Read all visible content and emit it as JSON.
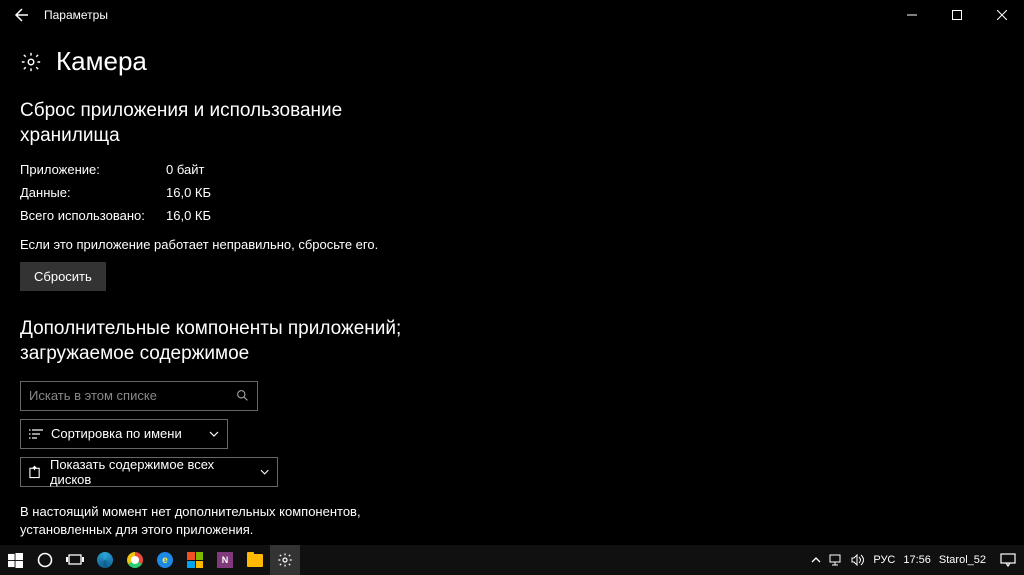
{
  "titlebar": {
    "title": "Параметры"
  },
  "header": {
    "title": "Камера"
  },
  "storage_section": {
    "heading": "Сброс приложения и использование хранилища",
    "rows": [
      {
        "label": "Приложение:",
        "value": "0 байт"
      },
      {
        "label": "Данные:",
        "value": "16,0 КБ"
      },
      {
        "label": "Всего использовано:",
        "value": "16,0 КБ"
      }
    ],
    "hint": "Если это приложение работает неправильно, сбросьте его.",
    "reset_button": "Сбросить"
  },
  "addons_section": {
    "heading": "Дополнительные компоненты приложений; загружаемое содержимое",
    "search_placeholder": "Искать в этом списке",
    "sort_label": "Сортировка по имени",
    "drives_label": "Показать содержимое всех дисков",
    "empty_text": "В настоящий момент нет дополнительных компонентов, установленных для этого приложения."
  },
  "taskbar": {
    "lang": "РУС",
    "clock": "17:56",
    "user": "Starol_52"
  }
}
